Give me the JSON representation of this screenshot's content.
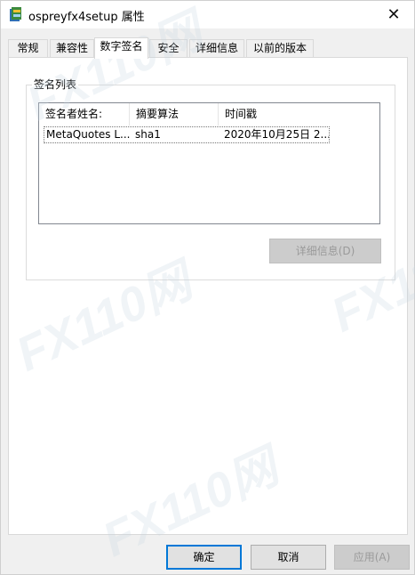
{
  "window": {
    "title": "ospreyfx4setup 属性",
    "close_glyph": "✕"
  },
  "tabs": [
    {
      "label": "常规",
      "active": false
    },
    {
      "label": "兼容性",
      "active": false
    },
    {
      "label": "数字签名",
      "active": true
    },
    {
      "label": "安全",
      "active": false
    },
    {
      "label": "详细信息",
      "active": false
    },
    {
      "label": "以前的版本",
      "active": false
    }
  ],
  "signature_list": {
    "group_title": "签名列表",
    "columns": [
      "签名者姓名:",
      "摘要算法",
      "时间戳"
    ],
    "rows": [
      {
        "signer": "MetaQuotes L...",
        "digest": "sha1",
        "timestamp": "2020年10月25日 2..."
      }
    ],
    "details_button": "详细信息(D)"
  },
  "footer": {
    "ok": "确定",
    "cancel": "取消",
    "apply": "应用(A)"
  },
  "watermark": {
    "text": "FX110网"
  },
  "colors": {
    "accent": "#0078d7",
    "window_bg": "#f0f0f0",
    "panel_bg": "#ffffff"
  }
}
